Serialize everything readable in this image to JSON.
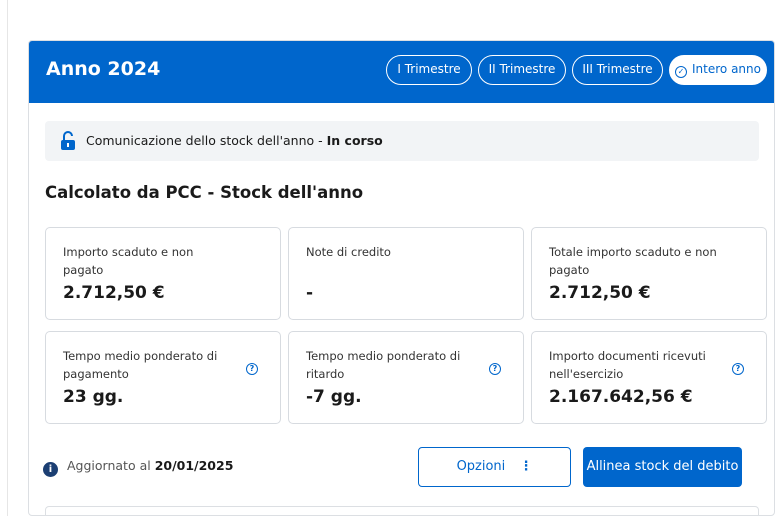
{
  "panel": {
    "title": "Anno 2024",
    "tabs": [
      {
        "label": "I Trimestre",
        "active": false
      },
      {
        "label": "II Trimestre",
        "active": false
      },
      {
        "label": "III Trimestre",
        "active": false
      },
      {
        "label": "Intero anno",
        "active": true
      }
    ]
  },
  "status": {
    "icon": "lock-open-icon",
    "text": "Comunicazione dello stock dell'anno",
    "separator": " - ",
    "state": "In corso"
  },
  "section": {
    "title": "Calcolato da PCC - Stock dell'anno"
  },
  "cards": [
    {
      "label": "Importo scaduto e non pagato",
      "value": "2.712,50 €",
      "help": false
    },
    {
      "label": "Note di credito",
      "value": "-",
      "help": false
    },
    {
      "label": "Totale importo scaduto e non pagato",
      "value": "2.712,50 €",
      "help": false
    },
    {
      "label": "Tempo medio ponderato di pagamento",
      "value": "23 gg.",
      "help": true
    },
    {
      "label": "Tempo medio ponderato di ritardo",
      "value": "-7 gg.",
      "help": true
    },
    {
      "label": "Importo documenti ricevuti nell'esercizio",
      "value": "2.167.642,56 €",
      "help": true
    }
  ],
  "footer": {
    "updated_label": "Aggiornato al",
    "updated_date": "20/01/2025",
    "options_label": "Opzioni",
    "align_label": "Allinea stock del debito"
  },
  "colors": {
    "primary": "#0066cc",
    "status_bg": "#f2f4f6",
    "info_icon": "#1c3f73"
  }
}
